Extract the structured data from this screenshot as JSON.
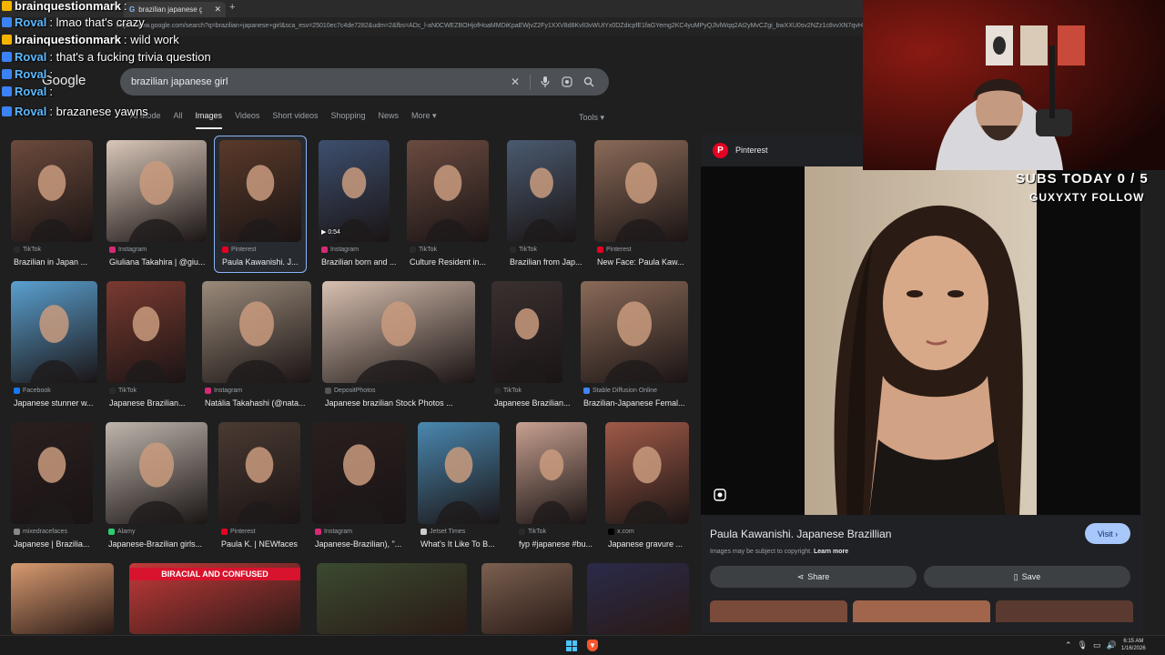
{
  "browser": {
    "tab_title": "brazilian japanese girl - Google",
    "url": "https://www.google.com/search?q=brazilian+japanese+girl&sca_esv=25010ec7c4de7282&udm=2&fbs=ADc_l-aN0CWEZBOHjofHoaMMDiKpaEWjvZ2Fy1XXV8d8KvlI3vWUtYx0DZdicpfE1faGYemg2KC4yuMPyQJlvlWqq2At2yMvCZgi_bwXXU0sv2NZz1c8vvXN7qvH5dSHDL2gzDVa8EQXPOe03G6oWgM1i7mQuRW"
  },
  "google": {
    "logo": "Google",
    "query": "brazilian japanese girl",
    "tabs": [
      "AI Mode",
      "All",
      "Images",
      "Videos",
      "Short videos",
      "Shopping",
      "News",
      "More ▾"
    ],
    "active_tab": "Images",
    "tools": "Tools ▾"
  },
  "results": [
    {
      "source": "TikTok",
      "title": "Brazilian in Japan ...",
      "fav": "#2a2a2a"
    },
    {
      "source": "Instagram",
      "title": "Giuliana Takahira | @giu...",
      "fav": "#d62976"
    },
    {
      "source": "Pinterest",
      "title": "Paula Kawanishi. J...",
      "fav": "#e60023"
    },
    {
      "source": "Instagram",
      "title": "Brazilian born and ...",
      "fav": "#d62976"
    },
    {
      "source": "TikTok",
      "title": "Culture Resident in...",
      "fav": "#2a2a2a"
    },
    {
      "source": "TikTok",
      "title": "Brazilian from Jap...",
      "fav": "#2a2a2a"
    },
    {
      "source": "Pinterest",
      "title": "New Face: Paula Kaw...",
      "fav": "#e60023"
    },
    {
      "source": "Facebook",
      "title": "Japanese stunner w...",
      "fav": "#1877f2"
    },
    {
      "source": "TikTok",
      "title": "Japanese Brazilian...",
      "fav": "#2a2a2a"
    },
    {
      "source": "Instagram",
      "title": "Natália Takahashi (@nata...",
      "fav": "#d62976"
    },
    {
      "source": "DepositPhotos",
      "title": "Japanese brazilian Stock Photos ...",
      "fav": "#555555"
    },
    {
      "source": "TikTok",
      "title": "Japanese Brazilian...",
      "fav": "#2a2a2a"
    },
    {
      "source": "Stable Diffusion Online",
      "title": "Brazilian-Japanese Femal...",
      "fav": "#4285f4"
    },
    {
      "source": "mixedracefaces",
      "title": "Japanese | Brazilia...",
      "fav": "#888888"
    },
    {
      "source": "Alamy",
      "title": "Japanese-Brazilian girls...",
      "fav": "#2ecc71"
    },
    {
      "source": "Pinterest",
      "title": "Paula K. | NEWfaces",
      "fav": "#e60023"
    },
    {
      "source": "Instagram",
      "title": "Japanese-Brazilian), \"...",
      "fav": "#d62976"
    },
    {
      "source": "Jetset Times",
      "title": "What's It Like To B...",
      "fav": "#cccccc"
    },
    {
      "source": "TikTok",
      "title": "fyp #japanese #bu...",
      "fav": "#2a2a2a"
    },
    {
      "source": "x.com",
      "title": "Japanese gravure ...",
      "fav": "#000000"
    }
  ],
  "thumb_overlays": {
    "video_duration": "0:54",
    "banner": "BIRACIAL AND CONFUSED"
  },
  "panel": {
    "site": "Pinterest",
    "title": "Paula Kawanishi. Japanese Brazillian",
    "visit": "Visit",
    "copyright": "Images may be subject to copyright.",
    "learn_more": "Learn more",
    "share": "Share",
    "save": "Save"
  },
  "overlay": {
    "subs": "SUBS TODAY 0 / 5",
    "follow": "GUXYXTY FOLLOW"
  },
  "chat": [
    {
      "user": "brainquestionmark",
      "text": "",
      "color": "#ffffff",
      "badge": "#f5b400"
    },
    {
      "user": "Roval",
      "text": "lmao that's crazy",
      "color": "#5cb8ff",
      "badge": "#3b82f6"
    },
    {
      "user": "brainquestionmark",
      "text": "wild work",
      "color": "#ffffff",
      "badge": "#f5b400"
    },
    {
      "user": "Roval",
      "text": "that's a fucking trivia question",
      "color": "#5cb8ff",
      "badge": "#3b82f6"
    },
    {
      "user": "Roval",
      "text": "",
      "color": "#5cb8ff",
      "badge": "#3b82f6"
    },
    {
      "user": "Roval",
      "text": "",
      "color": "#5cb8ff",
      "badge": "#3b82f6"
    },
    {
      "user": "Roval",
      "text": "brazanese yawns",
      "color": "#5cb8ff",
      "badge": "#3b82f6"
    }
  ],
  "clock": {
    "time": "6:15 AM",
    "date": "1/16/2026"
  }
}
